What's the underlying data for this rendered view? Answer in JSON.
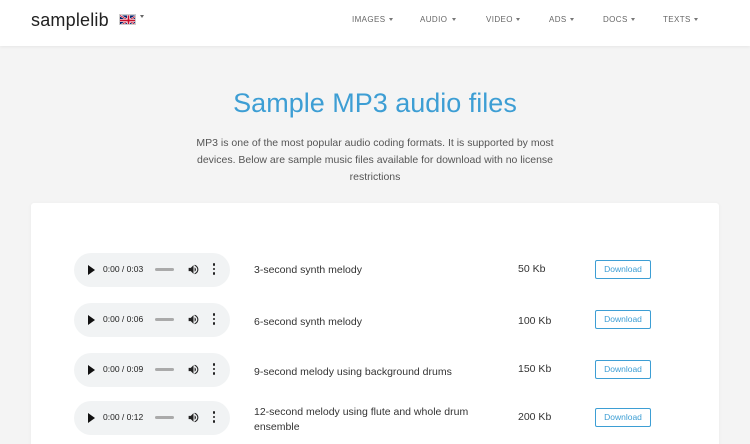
{
  "navbar": {
    "brand": "samplelib",
    "flag_icon": "uk-flag-icon",
    "items": [
      {
        "label": "IMAGES"
      },
      {
        "label": "AUDIO"
      },
      {
        "label": "VIDEO"
      },
      {
        "label": "ADS"
      },
      {
        "label": "DOCS"
      },
      {
        "label": "TEXTS"
      }
    ]
  },
  "hero": {
    "title": "Sample MP3 audio files",
    "description": "MP3 is one of the most popular audio coding formats. It is supported by most devices. Below are sample music files available for download with no license restrictions"
  },
  "colors": {
    "accent": "#3d9ed4",
    "background": "#f4f4f4",
    "player_bg": "#f1f3f4"
  },
  "files": [
    {
      "time": "0:00 / 0:03",
      "title": "3-second synth melody",
      "size": "50 Kb",
      "download_label": "Download",
      "progress": 0
    },
    {
      "time": "0:00 / 0:06",
      "title": "6-second synth melody",
      "size": "100 Kb",
      "download_label": "Download",
      "progress": 0
    },
    {
      "time": "0:00 / 0:09",
      "title": "9-second melody using background drums",
      "size": "150 Kb",
      "download_label": "Download",
      "progress": 0
    },
    {
      "time": "0:00 / 0:12",
      "title": "12-second melody using flute and whole drum ensemble",
      "size": "200 Kb",
      "download_label": "Download",
      "progress": 0
    }
  ]
}
